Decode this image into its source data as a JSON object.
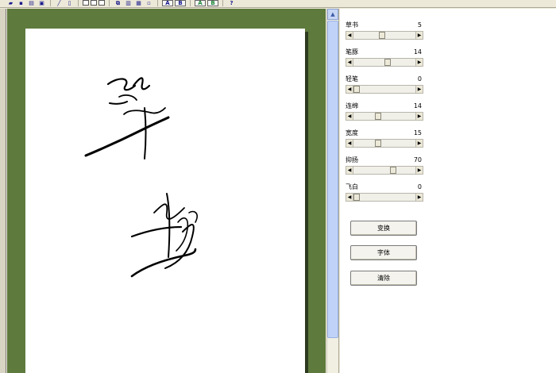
{
  "toolbar": {
    "buttons": [
      {
        "name": "open-icon",
        "glyph": "▰"
      },
      {
        "name": "save-icon",
        "glyph": "▪"
      },
      {
        "name": "print-icon",
        "glyph": "▤"
      },
      {
        "name": "preview-icon",
        "glyph": "▣"
      },
      {
        "name": "pen-icon",
        "glyph": "╱"
      },
      {
        "name": "page-icon",
        "glyph": "▯"
      }
    ],
    "text_a_label": "A",
    "text_b_label": "B"
  },
  "canvas": {
    "background_color": "#5e7a3d",
    "paper_color": "#ffffff"
  },
  "params": [
    {
      "label": "草书",
      "value": "5",
      "fraction": 0.45
    },
    {
      "label": "笔豚",
      "value": "14",
      "fraction": 0.55
    },
    {
      "label": "轻笔",
      "value": "0",
      "fraction": 0.0
    },
    {
      "label": "连绵",
      "value": "14",
      "fraction": 0.38
    },
    {
      "label": "宽度",
      "value": "15",
      "fraction": 0.38
    },
    {
      "label": "抑扬",
      "value": "70",
      "fraction": 0.66
    },
    {
      "label": "飞白",
      "value": "0",
      "fraction": 0.0
    }
  ],
  "buttons": {
    "transform": "变换",
    "font": "字体",
    "clear": "清除"
  }
}
